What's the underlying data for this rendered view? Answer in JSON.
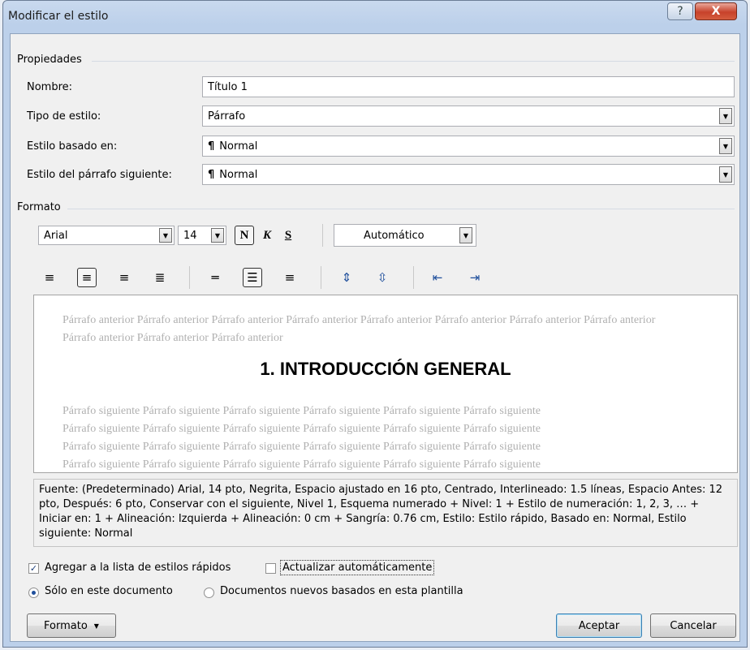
{
  "window": {
    "title": "Modificar el estilo",
    "help_glyph": "?",
    "close_glyph": "X"
  },
  "propiedades": {
    "group_label": "Propiedades",
    "nombre": {
      "label": "Nombre:",
      "value": "Título 1"
    },
    "tipo": {
      "label": "Tipo de estilo:",
      "value": "Párrafo"
    },
    "basado": {
      "label": "Estilo basado en:",
      "value": "Normal"
    },
    "siguiente": {
      "label": "Estilo del párrafo siguiente:",
      "value": "Normal"
    },
    "pilcrow": "¶"
  },
  "formato": {
    "group_label": "Formato",
    "font": "Arial",
    "size": "14",
    "bold": "N",
    "italic": "K",
    "underline": "S",
    "color": "Automático"
  },
  "preview": {
    "previous_text": "Párrafo anterior Párrafo anterior Párrafo anterior Párrafo anterior Párrafo anterior Párrafo anterior Párrafo anterior Párrafo anterior Párrafo anterior Párrafo anterior Párrafo anterior",
    "heading": "1.  INTRODUCCIÓN GENERAL",
    "next_lines": [
      "Párrafo siguiente Párrafo siguiente Párrafo siguiente Párrafo siguiente Párrafo siguiente Párrafo siguiente",
      "Párrafo siguiente Párrafo siguiente Párrafo siguiente Párrafo siguiente Párrafo siguiente Párrafo siguiente",
      "Párrafo siguiente Párrafo siguiente Párrafo siguiente Párrafo siguiente Párrafo siguiente Párrafo siguiente",
      "Párrafo siguiente Párrafo siguiente Párrafo siguiente Párrafo siguiente Párrafo siguiente Párrafo siguiente"
    ]
  },
  "description": "Fuente: (Predeterminado) Arial, 14 pto, Negrita, Espacio ajustado en 16 pto, Centrado, Interlineado:  1.5 líneas, Espacio Antes:  12 pto, Después:  6 pto, Conservar con el siguiente, Nivel 1, Esquema numerado + Nivel: 1 + Estilo de numeración: 1, 2, 3, … + Iniciar en: 1 + Alineación: Izquierda + Alineación:  0 cm + Sangría:  0.76 cm, Estilo: Estilo rápido, Basado en: Normal, Estilo siguiente: Normal",
  "options": {
    "quick_styles": {
      "label": "Agregar a la lista de estilos rápidos",
      "checked": true,
      "check_glyph": "✓"
    },
    "auto_update": {
      "label": "Actualizar automáticamente",
      "checked": false
    },
    "only_doc": {
      "label": "Sólo en este documento",
      "selected": true
    },
    "new_docs": {
      "label": "Documentos nuevos basados en esta plantilla",
      "selected": false
    }
  },
  "buttons": {
    "formato": "Formato",
    "aceptar": "Aceptar",
    "cancelar": "Cancelar"
  },
  "icons": {
    "dropdown": "▼",
    "align_left": "≡",
    "align_center": "≡",
    "align_right": "≡",
    "justify": "≣",
    "spacing_single": "═",
    "spacing_onehalf": "☰",
    "spacing_double": "≡",
    "para_space_increase": "⇕",
    "para_space_decrease": "⇳",
    "indent_decrease": "⇤",
    "indent_increase": "⇥"
  }
}
